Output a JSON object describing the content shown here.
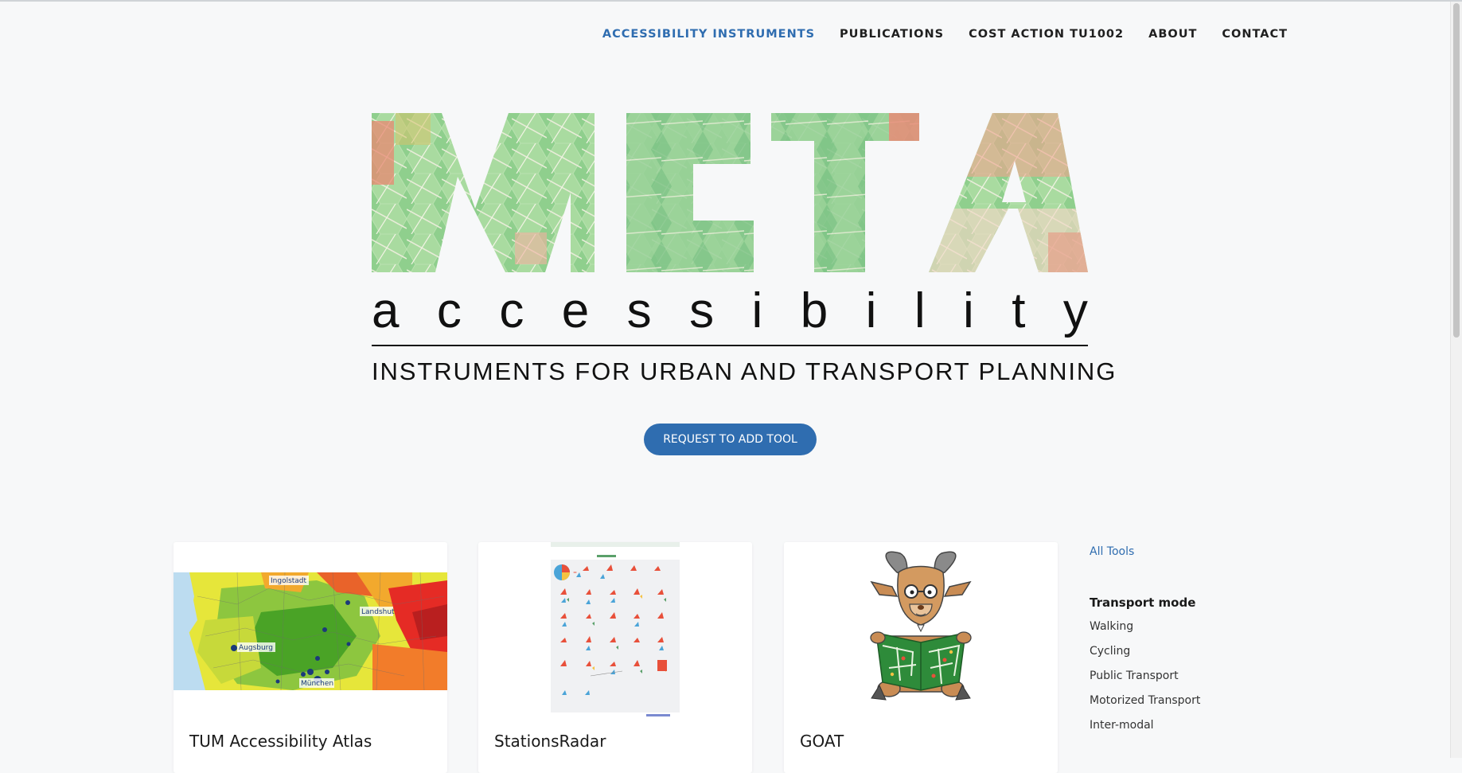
{
  "nav": {
    "items": [
      {
        "label": "ACCESSIBILITY INSTRUMENTS",
        "active": true
      },
      {
        "label": "PUBLICATIONS",
        "active": false
      },
      {
        "label": "COST ACTION TU1002",
        "active": false
      },
      {
        "label": "ABOUT",
        "active": false
      },
      {
        "label": "CONTACT",
        "active": false
      }
    ]
  },
  "logo": {
    "main": "META",
    "secondary": "accessibility",
    "tagline": "INSTRUMENTS FOR URBAN AND TRANSPORT PLANNING"
  },
  "request_button": "REQUEST TO ADD TOOL",
  "cards": [
    {
      "title": "TUM Accessibility Atlas",
      "map_labels": [
        "Ingolstadt",
        "Landshut",
        "Augsburg",
        "München"
      ]
    },
    {
      "title": "StationsRadar"
    },
    {
      "title": "GOAT"
    }
  ],
  "sidebar": {
    "all_tools": "All Tools",
    "transport_heading": "Transport mode",
    "transport_modes": [
      "Walking",
      "Cycling",
      "Public Transport",
      "Motorized Transport",
      "Inter-modal"
    ]
  },
  "colors": {
    "accent": "#2f6db0",
    "background": "#f7f8f9"
  }
}
